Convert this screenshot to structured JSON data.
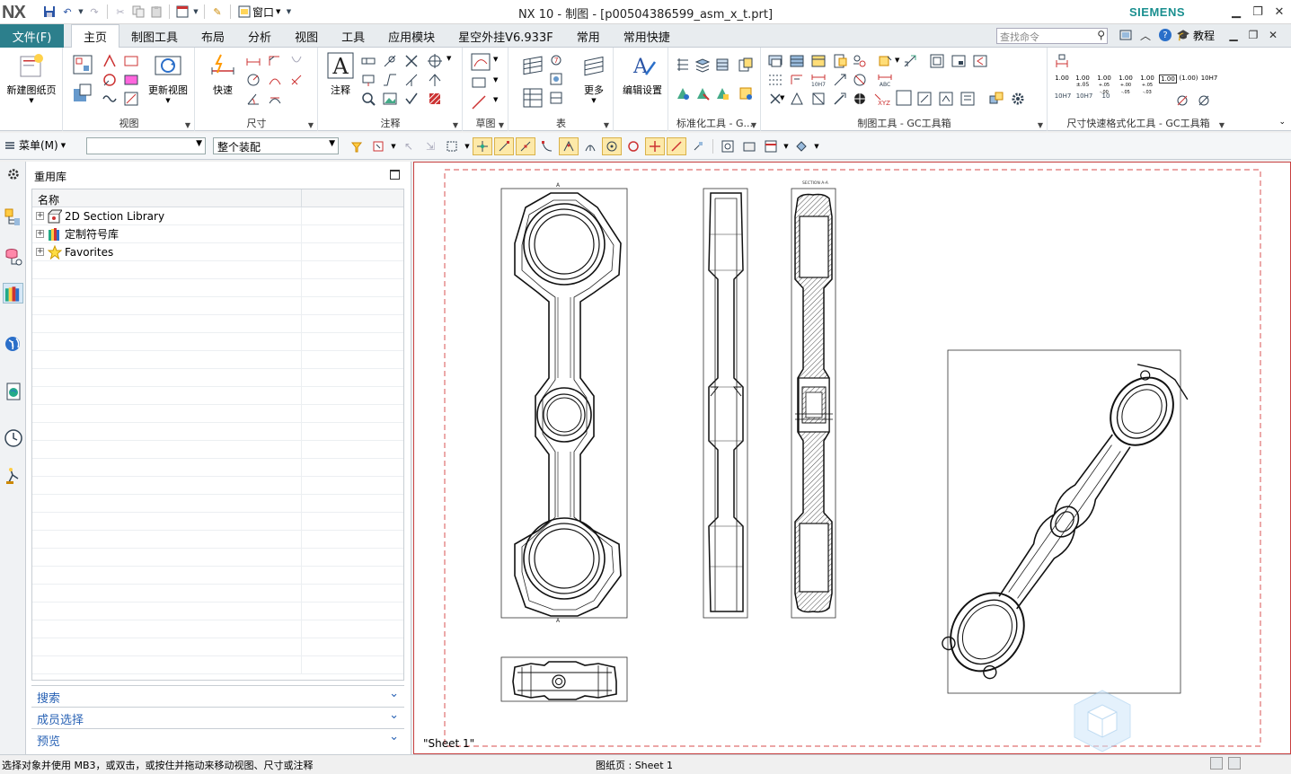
{
  "app": {
    "logo": "NX",
    "title": "NX 10 - 制图 - [p00504386599_asm_x_t.prt]",
    "brand": "SIEMENS",
    "window_menu": "窗口"
  },
  "ribbon_tabs": {
    "file": "文件(F)",
    "items": [
      "主页",
      "制图工具",
      "布局",
      "分析",
      "视图",
      "工具",
      "应用模块",
      "星空外挂V6.933F",
      "常用",
      "常用快捷"
    ],
    "active": "主页"
  },
  "command_search": {
    "placeholder": "查找命令"
  },
  "tutorial_label": "教程",
  "ribbon_groups": {
    "new_sheet": "新建图纸页",
    "view": "视图",
    "update_view": "更新视图",
    "quick": "快速",
    "dimension": "尺寸",
    "annotation_btn": "注释",
    "annotation": "注释",
    "sketch": "草图",
    "more": "更多",
    "table": "表",
    "edit_settings": "编辑设置",
    "std_tools": "标准化工具 - G...",
    "drafting_tools": "制图工具 - GC工具箱",
    "dim_format_tools": "尺寸快速格式化工具 - GC工具箱"
  },
  "dim_format_labels": [
    "1.00",
    "1.00",
    "1.00",
    "1.00",
    "1.00",
    "1.00",
    "(1.00)",
    "10H7",
    "10H7",
    "10H7",
    "10"
  ],
  "dim_format_sub": [
    "±.05",
    "+.05\n-.00",
    "+.00\n-.05",
    "+.05\n-.03"
  ],
  "xyz_label": "XYZ",
  "abc_label": "ABC",
  "selbar": {
    "menu": "菜单(M)",
    "filter": "",
    "scope": "整个装配"
  },
  "navigator": {
    "title": "重用库",
    "column_name": "名称",
    "items": [
      {
        "label": "2D Section Library"
      },
      {
        "label": "定制符号库"
      },
      {
        "label": "Favorites"
      }
    ],
    "sections": [
      "搜索",
      "成员选择",
      "预览"
    ]
  },
  "canvas": {
    "sheet_label": "\"Sheet 1\"",
    "section_note": "SECTION A-A"
  },
  "statusbar": {
    "message": "选择对象并使用 MB3，或双击，或按住并拖动来移动视图、尺寸或注释",
    "sheet": "图纸页 : Sheet 1"
  },
  "colors": {
    "file_tab": "#2c7f8c",
    "brand": "#1a8f8f",
    "border_red": "#c84040",
    "accordion": "#2a63b5"
  },
  "icons": [
    "save-icon",
    "undo-icon",
    "redo-icon",
    "cut-icon",
    "copy-icon",
    "paste-icon",
    "window-icon",
    "search-icon",
    "help-icon",
    "maximize-icon",
    "minimize-icon",
    "close-icon",
    "restore-icon",
    "settings-icon"
  ]
}
